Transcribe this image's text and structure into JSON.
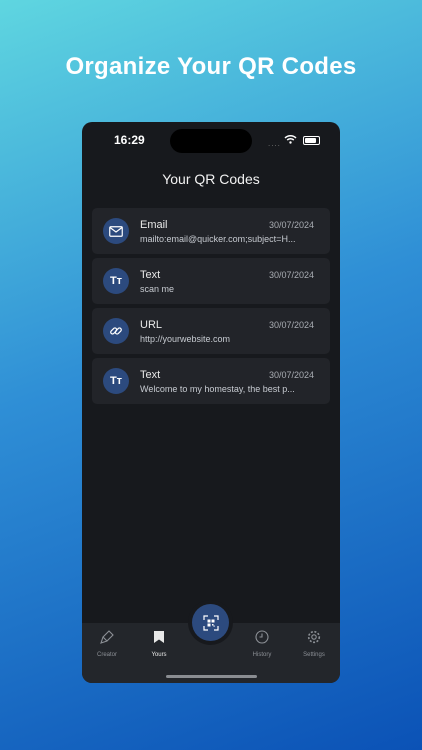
{
  "headline": "Organize Your QR Codes",
  "status": {
    "time": "16:29",
    "signal": "...."
  },
  "screen": {
    "title": "Your QR Codes",
    "items": [
      {
        "type": "Email",
        "date": "30/07/2024",
        "content": "mailto:email@quicker.com;subject=H...",
        "icon": "envelope-icon"
      },
      {
        "type": "Text",
        "date": "30/07/2024",
        "content": "scan me",
        "icon": "text-icon",
        "glyph": "Tт"
      },
      {
        "type": "URL",
        "date": "30/07/2024",
        "content": "http://yourwebsite.com",
        "icon": "link-icon"
      },
      {
        "type": "Text",
        "date": "30/07/2024",
        "content": "Welcome to my homestay, the best p...",
        "icon": "text-icon",
        "glyph": "Tт"
      }
    ]
  },
  "tabs": {
    "creator": "Creator",
    "yours": "Yours",
    "history": "History",
    "settings": "Settings",
    "active": "Yours"
  },
  "colors": {
    "accent": "#2c4a7e",
    "background": "#17191d",
    "card": "#222429"
  }
}
